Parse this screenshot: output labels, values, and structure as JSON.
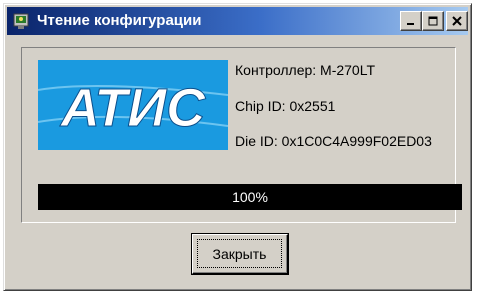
{
  "window": {
    "title": "Чтение конфигурации",
    "icon": "app-icon"
  },
  "logo": {
    "text": "АТИС",
    "background": "#1a9ae0"
  },
  "info": {
    "controller": "Контроллер: M-270LT",
    "chip_id": "Chip ID: 0x2551",
    "die_id": "Die ID:   0x1C0C4A999F02ED03"
  },
  "progress": {
    "value": 1.0,
    "text": "100%"
  },
  "buttons": {
    "close_label": "Закрыть"
  }
}
